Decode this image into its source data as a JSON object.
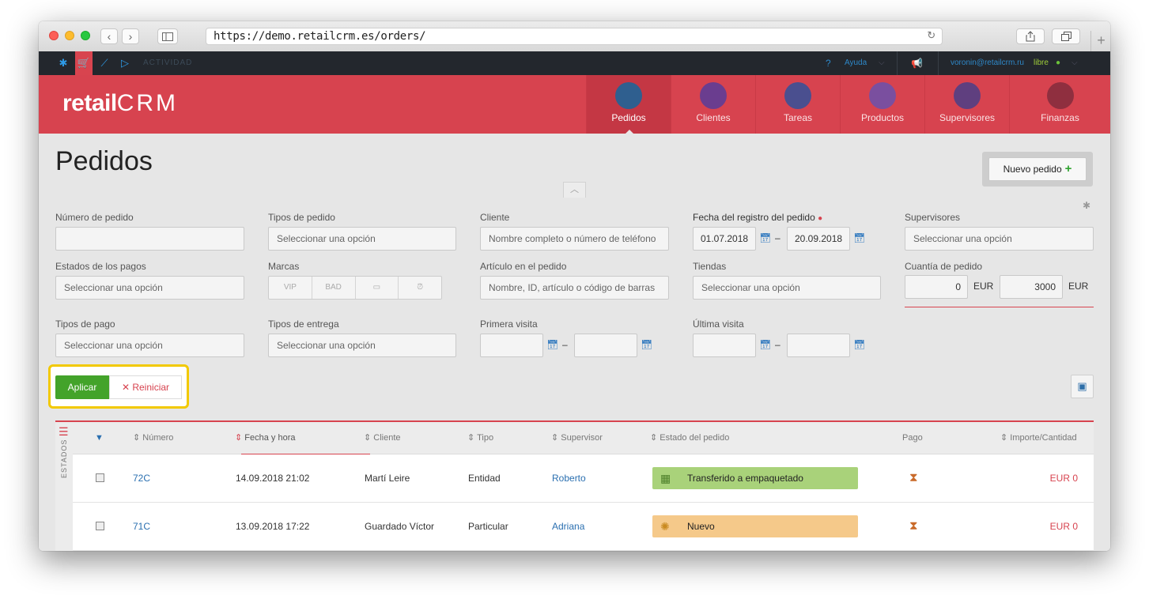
{
  "browser": {
    "url": "https://demo.retailcrm.es/orders/",
    "back_icon": "‹",
    "forward_icon": "›"
  },
  "topbar": {
    "activity_label": "ACTIVIDAD",
    "help_label": "Ayuda",
    "user_email": "voronin@retailcrm.ru",
    "user_status": "libre"
  },
  "header": {
    "logo_text": "retail",
    "logo_crm": "CRM",
    "nav": [
      {
        "label": "Pedidos",
        "icon": "cart-icon",
        "color": "#2f5f8f"
      },
      {
        "label": "Clientes",
        "icon": "customer-icon",
        "color": "#6a3d8f"
      },
      {
        "label": "Tareas",
        "icon": "tasks-icon",
        "color": "#4a4f8f"
      },
      {
        "label": "Productos",
        "icon": "box-icon",
        "color": "#7a4f9f"
      },
      {
        "label": "Supervisores",
        "icon": "manager-icon",
        "color": "#5f3f7f"
      },
      {
        "label": "Finanzas",
        "icon": "finance-icon",
        "color": "#8f2f3f"
      }
    ]
  },
  "page": {
    "title": "Pedidos",
    "new_order_label": "Nuevo pedido"
  },
  "filters": {
    "order_number_label": "Número de pedido",
    "order_types_label": "Tipos de pedido",
    "order_types_placeholder": "Seleccionar una opción",
    "client_label": "Cliente",
    "client_placeholder": "Nombre completo o número de teléfono",
    "reg_date_label": "Fecha del registro del pedido",
    "reg_date_from": "01.07.2018",
    "reg_date_to": "20.09.2018",
    "managers_label": "Supervisores",
    "managers_placeholder": "Seleccionar una opción",
    "payment_status_label": "Estados de los pagos",
    "payment_status_placeholder": "Seleccionar una opción",
    "marks_label": "Marcas",
    "marks": [
      "VIP",
      "BAD",
      "",
      ""
    ],
    "product_label": "Artículo en el pedido",
    "product_placeholder": "Nombre, ID, artículo o código de barras",
    "shops_label": "Tiendas",
    "shops_placeholder": "Seleccionar una opción",
    "amount_label": "Cuantía de pedido",
    "amount_from": "0",
    "amount_to": "3000",
    "currency": "EUR",
    "payment_types_label": "Tipos de pago",
    "payment_types_placeholder": "Seleccionar una opción",
    "delivery_types_label": "Tipos de entrega",
    "delivery_types_placeholder": "Seleccionar una opción",
    "first_visit_label": "Primera visita",
    "last_visit_label": "Última visita",
    "dash": "–",
    "apply_label": "Aplicar",
    "reset_label": "Reiniciar"
  },
  "table": {
    "side_tab_label": "ESTADOS",
    "columns": {
      "number": "Número",
      "datetime": "Fecha y hora",
      "client": "Cliente",
      "type": "Tipo",
      "manager": "Supervisor",
      "status": "Estado del pedido",
      "payment": "Pago",
      "amount": "Importe/Cantidad"
    },
    "rows": [
      {
        "number": "72C",
        "datetime": "14.09.2018 21:02",
        "client": "Martí Leire",
        "type": "Entidad",
        "manager": "Roberto",
        "status": "Transferido a empaquetado",
        "status_color": "#a9d27a",
        "amount": "EUR 0"
      },
      {
        "number": "71C",
        "datetime": "13.09.2018 17:22",
        "client": "Guardado Víctor",
        "type": "Particular",
        "manager": "Adriana",
        "status": "Nuevo",
        "status_color": "#f5c98a",
        "amount": "EUR 0"
      }
    ]
  }
}
